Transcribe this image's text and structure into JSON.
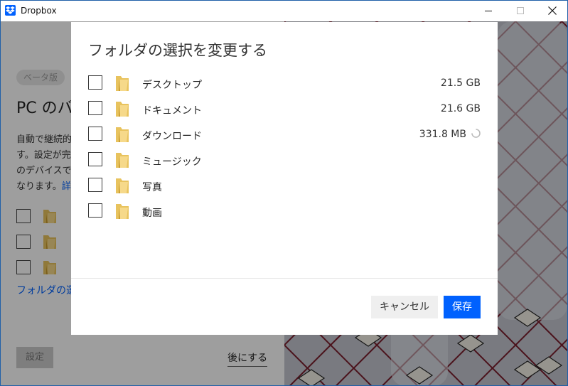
{
  "window": {
    "title": "Dropbox",
    "controls": {
      "minimize_icon": "minimize-icon",
      "maximize_icon": "maximize-icon",
      "close_icon": "close-icon"
    }
  },
  "background": {
    "badge": "ベータ版",
    "heading": "PC のバ",
    "description_lines": [
      "自動で継続的",
      "す。設定が完",
      "のデバイスで",
      "なります。"
    ],
    "description_link": "詳",
    "folder_link": "フォルダの選",
    "settings_button": "設定",
    "later_button": "後にする"
  },
  "dialog": {
    "title": "フォルダの選択を変更する",
    "folders": [
      {
        "name": "デスクトップ",
        "size": "21.5 GB",
        "loading": false
      },
      {
        "name": "ドキュメント",
        "size": "21.6 GB",
        "loading": false
      },
      {
        "name": "ダウンロード",
        "size": "331.8 MB",
        "loading": true
      },
      {
        "name": "ミュージック",
        "size": "",
        "loading": false
      },
      {
        "name": "写真",
        "size": "",
        "loading": false
      },
      {
        "name": "動画",
        "size": "",
        "loading": false
      }
    ],
    "cancel_label": "キャンセル",
    "save_label": "保存"
  },
  "colors": {
    "accent": "#0061fe",
    "overlay": "#000000",
    "artwork_grid": "#7a1f2e"
  }
}
